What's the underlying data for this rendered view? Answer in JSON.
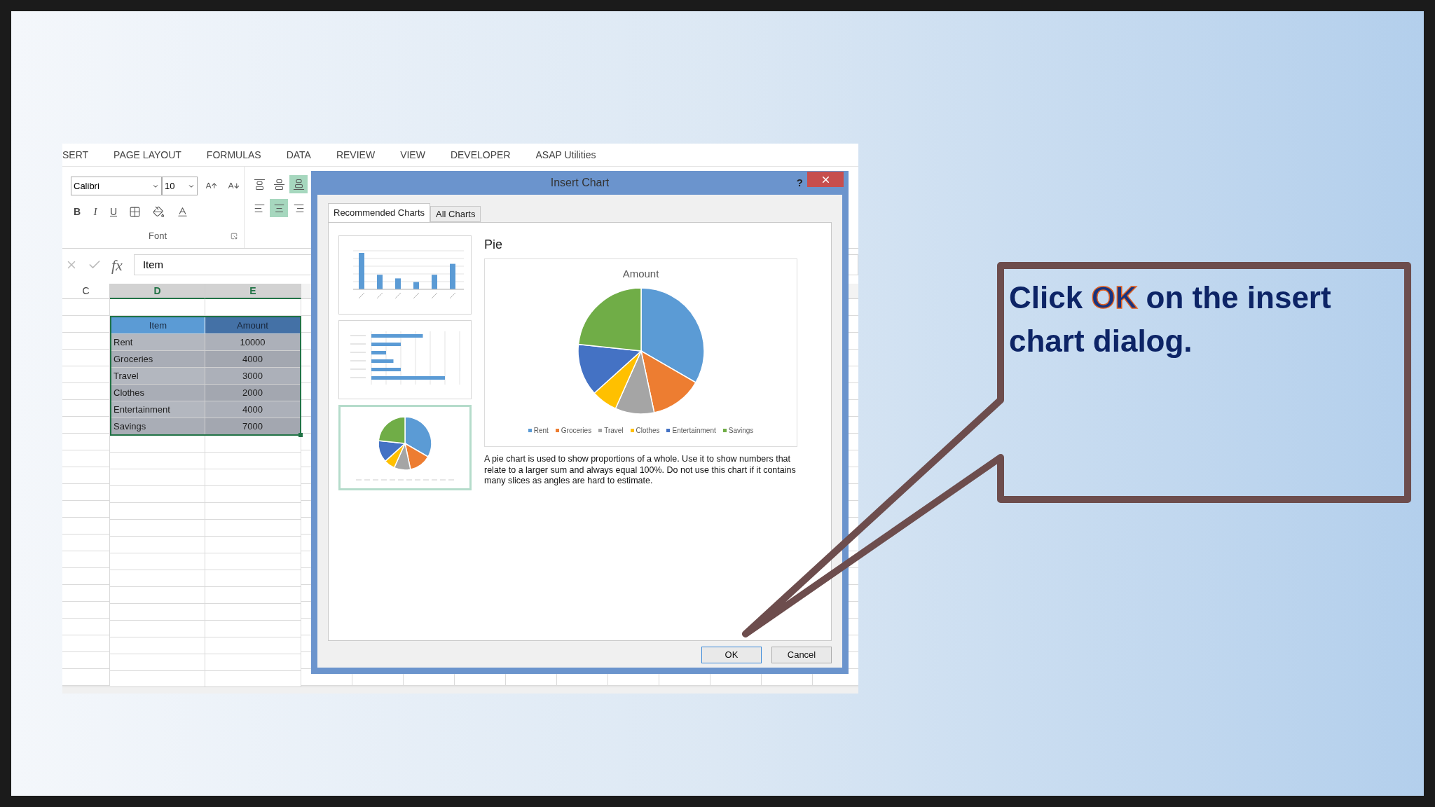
{
  "ribbon_tabs": [
    "SERT",
    "PAGE LAYOUT",
    "FORMULAS",
    "DATA",
    "REVIEW",
    "VIEW",
    "DEVELOPER",
    "ASAP Utilities"
  ],
  "font_group": {
    "font_name": "Calibri",
    "font_size": "10",
    "style_buttons": [
      "B",
      "I",
      "U"
    ],
    "label": "Font"
  },
  "formula_bar": {
    "function_label": "fx",
    "value": "Item"
  },
  "column_headers": [
    {
      "label": "C",
      "selected": false
    },
    {
      "label": "D",
      "selected": true
    },
    {
      "label": "E",
      "selected": true
    }
  ],
  "table": {
    "columns": [
      "Item",
      "Amount"
    ],
    "rows": [
      {
        "item": "Rent",
        "amount": "10000"
      },
      {
        "item": "Groceries",
        "amount": "4000"
      },
      {
        "item": "Travel",
        "amount": "3000"
      },
      {
        "item": "Clothes",
        "amount": "2000"
      },
      {
        "item": "Entertainment",
        "amount": "4000"
      },
      {
        "item": "Savings",
        "amount": "7000"
      }
    ]
  },
  "dialog": {
    "title": "Insert Chart",
    "help": "?",
    "tabs": [
      {
        "label": "Recommended Charts",
        "selected": true
      },
      {
        "label": "All Charts",
        "selected": false
      }
    ],
    "thumbnails": [
      {
        "kind": "column",
        "selected": false
      },
      {
        "kind": "bar",
        "selected": false
      },
      {
        "kind": "pie",
        "selected": true
      }
    ],
    "chart_name": "Pie",
    "preview": {
      "title": "Amount",
      "legend": [
        {
          "label": "Rent",
          "color": "#5b9bd5"
        },
        {
          "label": "Groceries",
          "color": "#ed7d31"
        },
        {
          "label": "Travel",
          "color": "#a5a5a5"
        },
        {
          "label": "Clothes",
          "color": "#ffc000"
        },
        {
          "label": "Entertainment",
          "color": "#4472c4"
        },
        {
          "label": "Savings",
          "color": "#70ad47"
        }
      ]
    },
    "description": "A pie chart is used to show proportions of a whole. Use it to show numbers that relate to a larger sum and always equal 100%. Do not use this chart if it contains many slices as angles are hard to estimate.",
    "buttons": [
      {
        "label": "OK",
        "kind": "default"
      },
      {
        "label": "Cancel",
        "kind": "normal"
      }
    ]
  },
  "callout": {
    "parts": [
      {
        "text": "Click ",
        "highlight": false
      },
      {
        "text": "OK",
        "highlight": true
      },
      {
        "text": " on the insert chart dialog.",
        "highlight": false
      }
    ]
  }
}
